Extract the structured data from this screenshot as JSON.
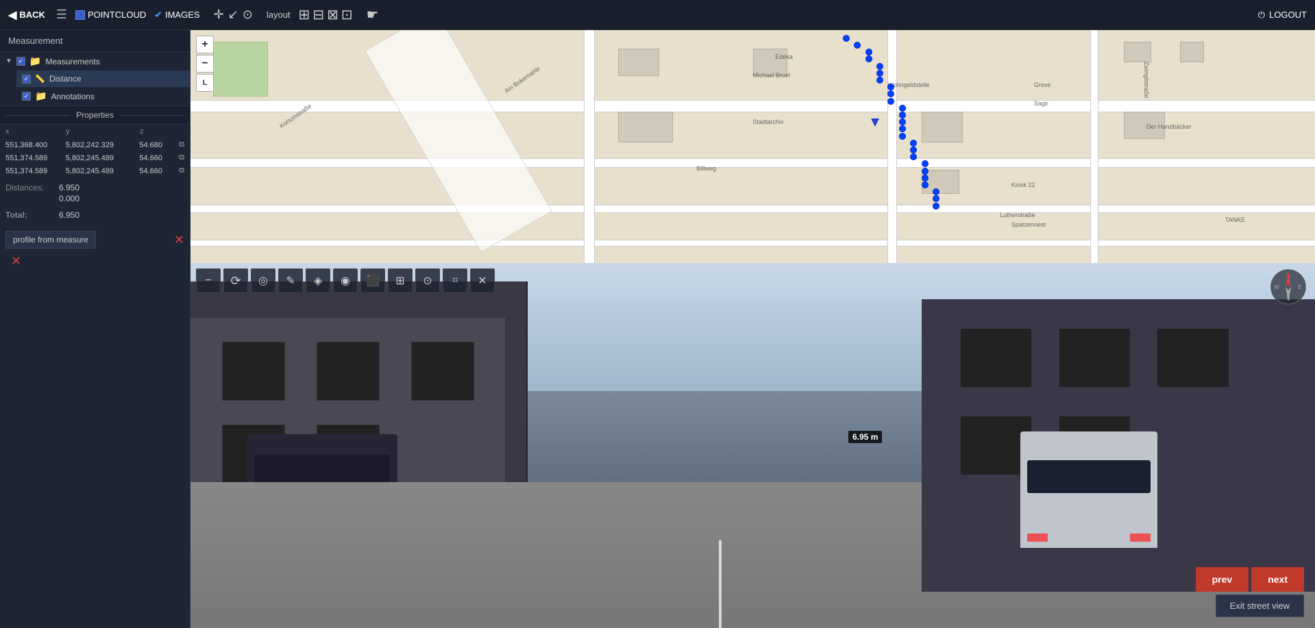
{
  "topbar": {
    "back_label": "BACK",
    "hamburger": "☰",
    "pointcloud_label": "POINTCLOUD",
    "images_label": "IMAGES",
    "layout_label": "layout",
    "logout_label": "LOGOUT",
    "toolbar_icons": [
      "✛",
      "↙",
      "⊙"
    ],
    "layout_icons": [
      "⊞",
      "⊟",
      "⊠",
      "⊡"
    ],
    "cursor_icon": "☛"
  },
  "left_panel": {
    "title": "Measurement",
    "tree": {
      "measurements_label": "Measurements",
      "distance_label": "Distance",
      "annotations_label": "Annotations"
    },
    "properties_label": "Properties",
    "coords": {
      "headers": {
        "x": "x",
        "y": "y",
        "z": "z"
      },
      "rows": [
        {
          "x": "551,368.400",
          "y": "5,802,242.329",
          "z": "54.680"
        },
        {
          "x": "551,374.589",
          "y": "5,802,245.489",
          "z": "54.660"
        },
        {
          "x": "551,374.589",
          "y": "5,802,245.489",
          "z": "54.660"
        }
      ]
    },
    "distances_label": "Distances:",
    "dist_values": [
      "6.950",
      "0.000"
    ],
    "total_label": "Total:",
    "total_value": "6.950",
    "profile_btn_label": "profile from measure"
  },
  "map": {
    "zoom_plus": "+",
    "zoom_minus": "-",
    "zoom_l": "L",
    "track_dots_count": 25,
    "street_labels": [
      "Kortumstraße",
      "Am Bokemahle",
      "Billweg",
      "Zwinglistraße",
      "Lutherstraße"
    ],
    "map_labels_misc": [
      "Edeka",
      "Michael Bruel",
      "Wohngeldstelle",
      "Grove",
      "Stadtarchiv",
      "Sagir",
      "Kiosk 22",
      "Spatzennest",
      "Der Handbacker",
      "TANKE"
    ]
  },
  "street_view": {
    "toolbar_buttons": [
      "-",
      "⟳",
      "◎",
      "✎",
      "◈",
      "✿",
      "⬛",
      "⊞",
      "⊙",
      "⌗",
      "✕"
    ],
    "measurement_label": "6.95 m",
    "prev_label": "prev",
    "next_label": "next",
    "exit_label": "Exit street view"
  },
  "colors": {
    "accent_blue": "#3a5fc8",
    "track_blue": "#0044ff",
    "measurement_red": "#ff3333",
    "btn_red": "#c0392b",
    "panel_bg": "#1e2535",
    "topbar_bg": "#1a1f2e"
  }
}
